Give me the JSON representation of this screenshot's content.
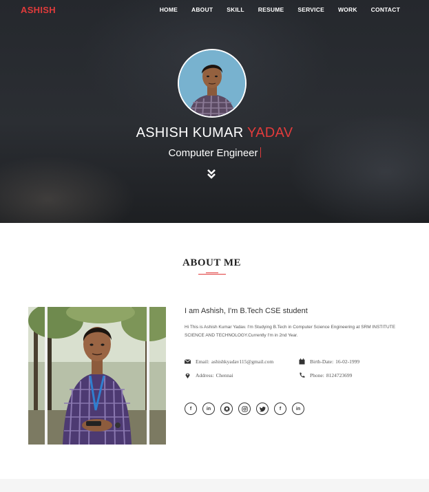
{
  "nav": {
    "brand": "ASHISH",
    "items": [
      "HOME",
      "ABOUT",
      "SKILL",
      "RESUME",
      "SERVICE",
      "WORK",
      "CONTACT"
    ]
  },
  "hero": {
    "name_first": "ASHISH KUMAR",
    "name_last": "YADAV",
    "role": "Computer Engineer"
  },
  "about": {
    "title": "ABOUT ME",
    "intro": "I am Ashish, I'm B.Tech CSE student",
    "description": "Hi This is Ashish Kumar Yadav. I'm Studying B.Tech in Computer Science Engineering at SRM INSTITUTE SCIENCE AND TECHNOLOGY.Currently I'm in 2nd Year.",
    "email_label": "Email:",
    "email": "ashishkyadav115@gmail.com",
    "birth_label": "Birth-Date:",
    "birth": "16-02-1999",
    "address_label": "Address:",
    "address": "Chennai",
    "phone_label": "Phone:",
    "phone": "8124723699"
  },
  "socials": [
    {
      "icon": "facebook-icon",
      "glyph": "f"
    },
    {
      "icon": "linkedin-icon",
      "glyph": "in"
    },
    {
      "icon": "github-icon",
      "glyph": ""
    },
    {
      "icon": "instagram-icon",
      "glyph": ""
    },
    {
      "icon": "twitter-icon",
      "glyph": ""
    },
    {
      "icon": "facebook-icon",
      "glyph": "f"
    },
    {
      "icon": "linkedin-icon",
      "glyph": "in"
    }
  ],
  "colors": {
    "accent": "#e03b3b",
    "hero_bg": "#2b2e33",
    "text": "#333333"
  }
}
